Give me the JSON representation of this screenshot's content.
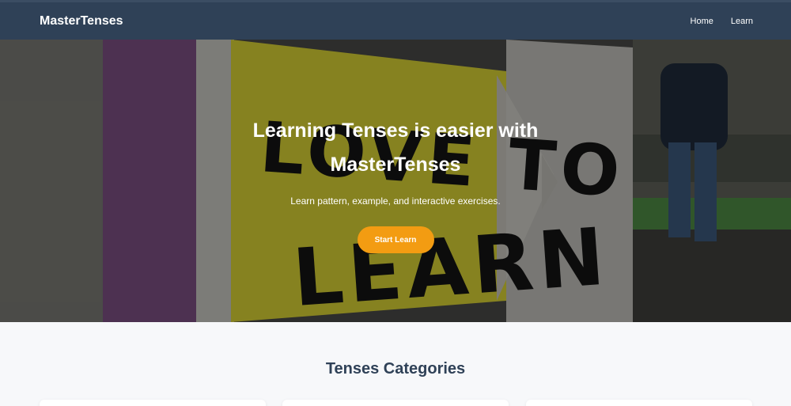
{
  "navbar": {
    "brand": "MasterTenses",
    "links": [
      "Home",
      "Learn"
    ]
  },
  "hero": {
    "title": "Learning Tenses is easier with MasterTenses",
    "subtitle": "Learn pattern, example, and interactive exercises.",
    "cta_label": "Start Learn",
    "background_sign_text": [
      "LOVE TO",
      "LEARN"
    ]
  },
  "categories": {
    "title": "Tenses Categories",
    "cards": [
      "",
      "",
      ""
    ]
  },
  "colors": {
    "navbar": "#2f4157",
    "accent": "#f39c12",
    "heading": "#2f4157"
  }
}
